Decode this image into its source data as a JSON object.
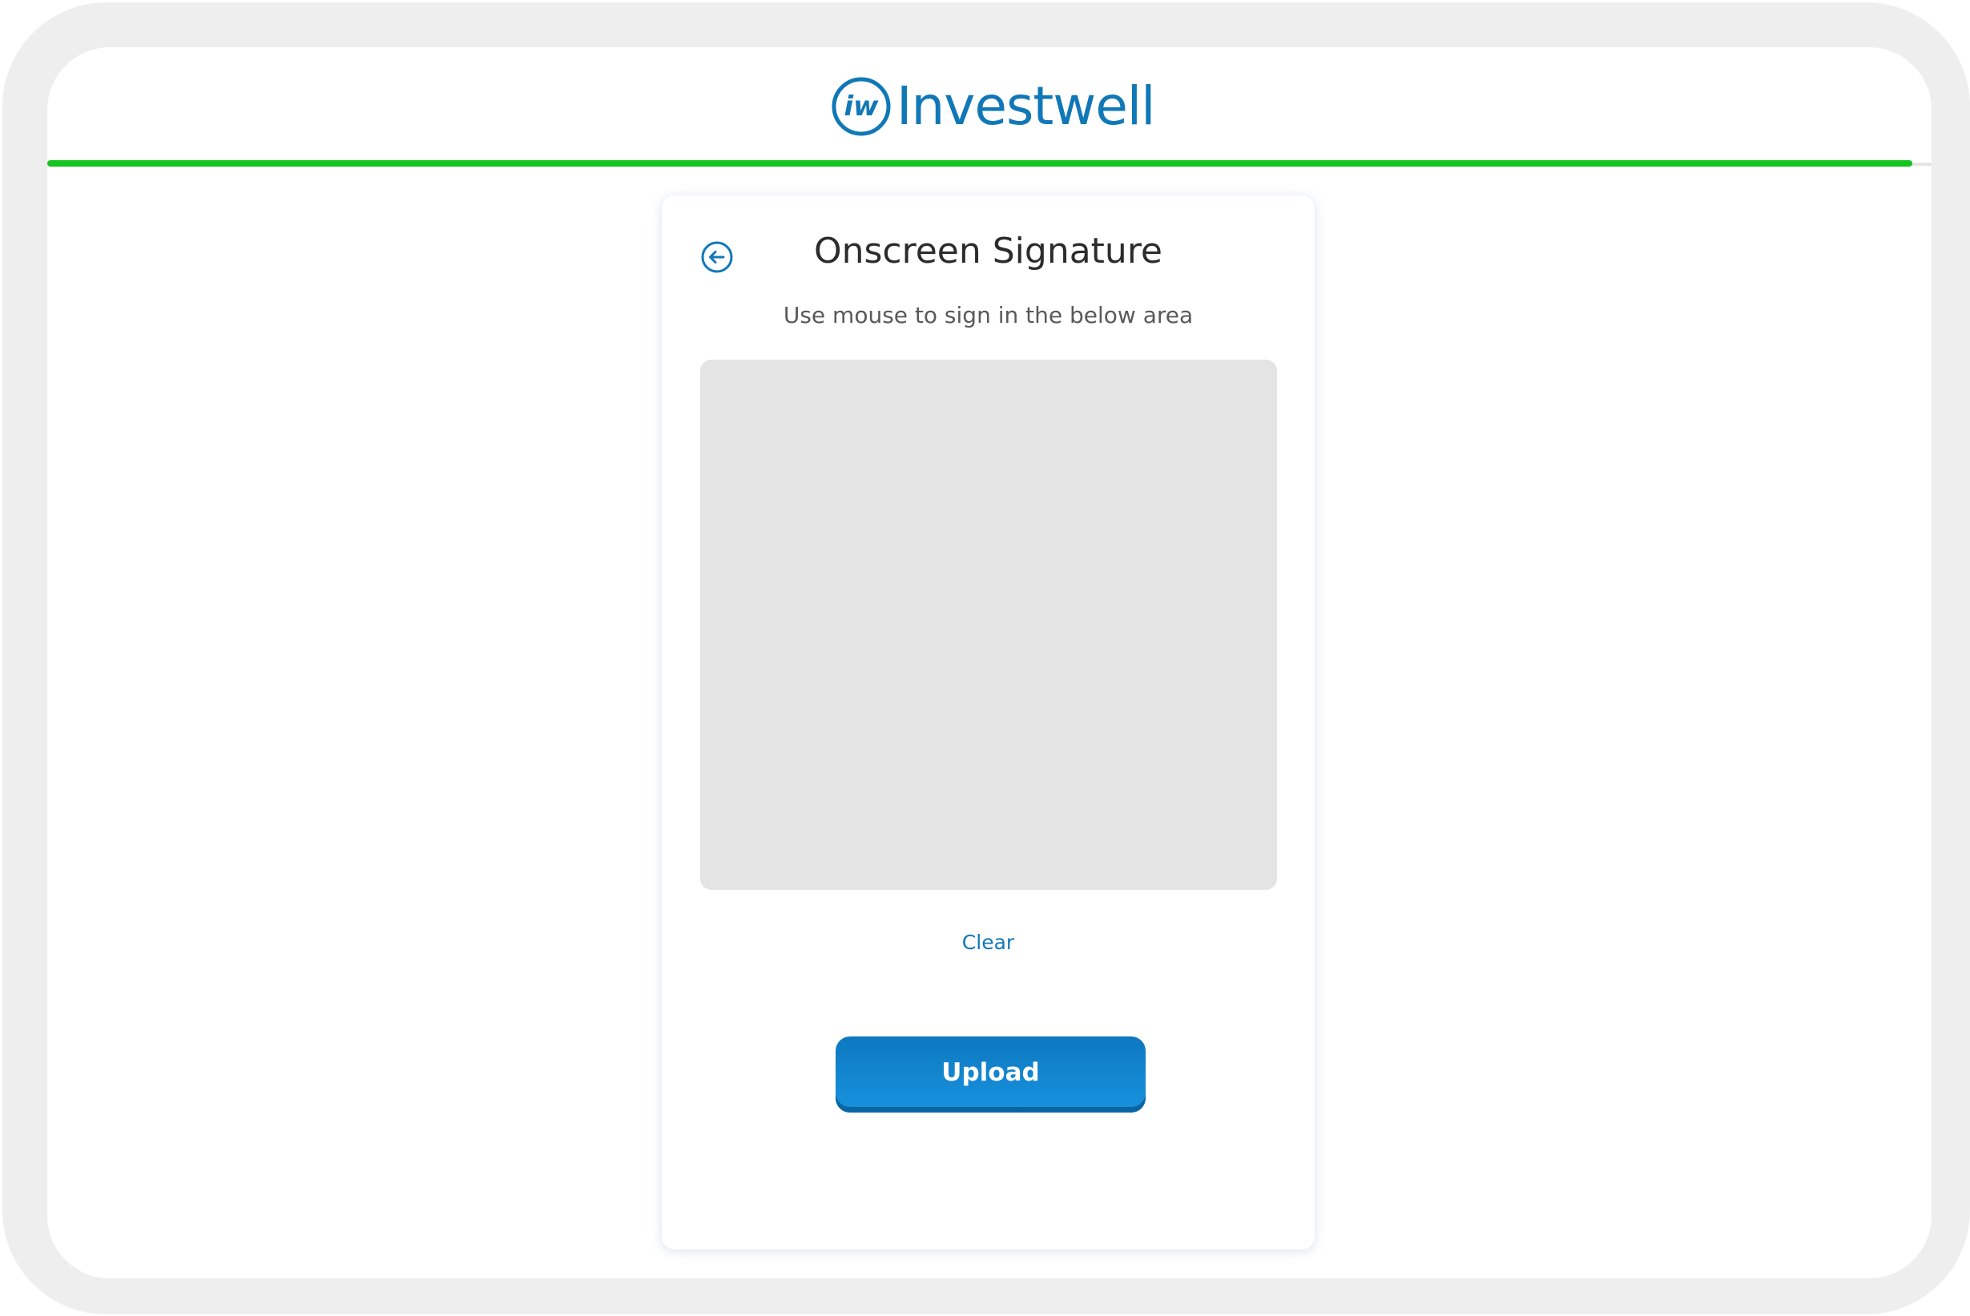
{
  "brand": {
    "name": "Investwell",
    "mark_text": "iw",
    "color": "#1178b7"
  },
  "progress": {
    "percent": 99,
    "color": "#15c41f"
  },
  "card": {
    "title": "Onscreen Signature",
    "subtitle": "Use mouse to sign in the below area",
    "back_icon": "arrow-left-circle-icon",
    "clear_label": "Clear",
    "upload_label": "Upload",
    "pad_color": "#e4e4e4",
    "button_color": "#1888d2"
  }
}
